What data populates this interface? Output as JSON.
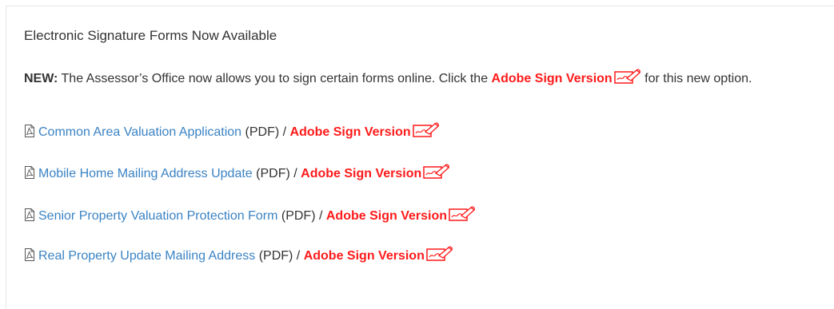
{
  "section": {
    "title": "Electronic Signature Forms Now Available",
    "intro": {
      "new_label": "NEW:",
      "text_before": " The Assessor’s Office now allows you to sign certain forms online. Click the ",
      "adobe_label": "Adobe Sign Version",
      "text_after": " for this new option."
    }
  },
  "forms": [
    {
      "name": "Common Area Valuation Application",
      "type": "(PDF)",
      "separator": " / ",
      "adobe_label": "Adobe Sign Version"
    },
    {
      "name": "Mobile Home Mailing Address Update",
      "type": "(PDF)",
      "separator": " / ",
      "adobe_label": "Adobe Sign Version"
    },
    {
      "name": "Senior Property Valuation Protection Form",
      "type": "(PDF)",
      "separator": " / ",
      "adobe_label": "Adobe Sign Version"
    },
    {
      "name": "Real Property Update Mailing Address",
      "type": "(PDF)",
      "separator": " / ",
      "adobe_label": "Adobe Sign Version"
    }
  ],
  "icons": {
    "pdf": "pdf-file-icon",
    "sign": "adobe-sign-icon"
  },
  "colors": {
    "link": "#3b83c4",
    "adobe": "#ff1a1a",
    "text": "#333333"
  }
}
